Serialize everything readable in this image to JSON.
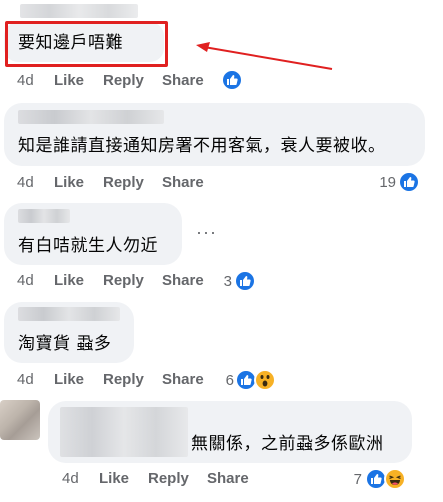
{
  "accent_color": "#1b74e4",
  "annotation_color": "#e02020",
  "comments": [
    {
      "text": "要知邊戶唔難",
      "time": "4d",
      "like": "Like",
      "reply": "Reply",
      "share": "Share",
      "reaction_count": "",
      "reactions": [
        "like-icon"
      ]
    },
    {
      "text": "知是誰請直接通知房署不用客氣，衰人要被收。",
      "time": "4d",
      "like": "Like",
      "reply": "Reply",
      "share": "Share",
      "reaction_count": "19",
      "reactions": [
        "like-icon"
      ]
    },
    {
      "text": "有白咭就生人勿近",
      "time": "4d",
      "like": "Like",
      "reply": "Reply",
      "share": "Share",
      "reaction_count": "3",
      "reactions": [
        "like-icon"
      ],
      "more_options": "···"
    },
    {
      "text": "淘寶貨 蝨多",
      "time": "4d",
      "like": "Like",
      "reply": "Reply",
      "share": "Share",
      "reaction_count": "6",
      "reactions": [
        "like-icon",
        "wow-icon"
      ]
    },
    {
      "text": "無關係，之前蝨多係歐洲",
      "time": "4d",
      "like": "Like",
      "reply": "Reply",
      "share": "Share",
      "reaction_count": "7",
      "reactions": [
        "like-icon",
        "haha-icon"
      ]
    }
  ]
}
